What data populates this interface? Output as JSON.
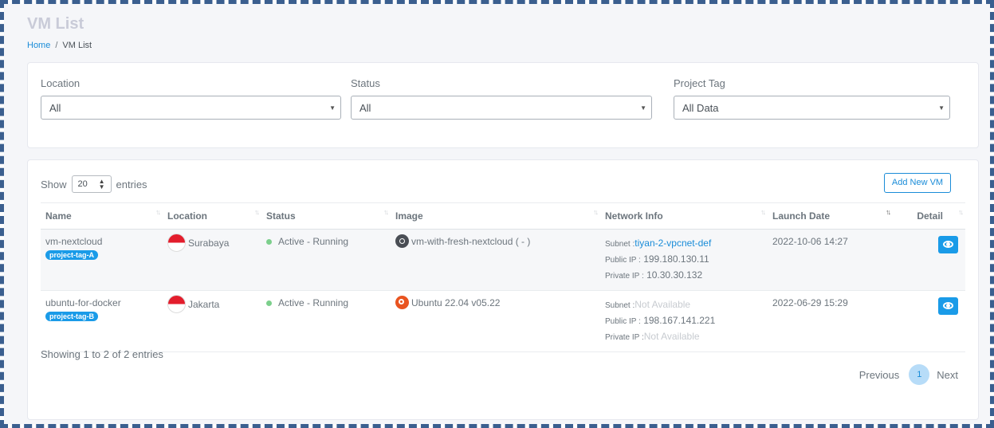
{
  "header": {
    "title": "VM List",
    "breadcrumb": {
      "home": "Home",
      "separator": "/",
      "current": "VM List"
    }
  },
  "filters": {
    "location": {
      "label": "Location",
      "value": "All"
    },
    "status": {
      "label": "Status",
      "value": "All"
    },
    "project_tag": {
      "label": "Project Tag",
      "value": "All Data"
    }
  },
  "table_controls": {
    "show_label": "Show",
    "page_length": "20",
    "entries_label": "entries",
    "add_button": "Add New VM"
  },
  "columns": [
    "Name",
    "Location",
    "Status",
    "Image",
    "Network Info",
    "Launch Date",
    "Detail"
  ],
  "rows": [
    {
      "name": "vm-nextcloud",
      "tag": "project-tag-A",
      "location": "Surabaya",
      "status": "Active - Running",
      "image": "vm-with-fresh-nextcloud ( - )",
      "image_icon": "nextcloud-icon",
      "subnet_label": "Subnet :",
      "subnet": "tiyan-2-vpcnet-def",
      "public_label": "Public IP :",
      "public_ip": "199.180.130.11",
      "private_label": "Private IP :",
      "private_ip": "10.30.30.132",
      "launch_date": "2022-10-06 14:27"
    },
    {
      "name": "ubuntu-for-docker",
      "tag": "project-tag-B",
      "location": "Jakarta",
      "status": "Active - Running",
      "image": "Ubuntu 22.04 v05.22",
      "image_icon": "ubuntu-icon",
      "subnet_label": "Subnet :",
      "subnet": "Not Available",
      "public_label": "Public IP :",
      "public_ip": "198.167.141.221",
      "private_label": "Private IP :",
      "private_ip": "Not Available",
      "launch_date": "2022-06-29 15:29"
    }
  ],
  "footer": {
    "showing": "Showing 1 to 2 of 2 entries",
    "previous": "Previous",
    "current_page": "1",
    "next": "Next"
  },
  "colors": {
    "accent": "#1a8cd8",
    "tag_bg": "#1a9be8",
    "status_active": "#7ccf8c",
    "page_bg": "#f5f6f9"
  }
}
